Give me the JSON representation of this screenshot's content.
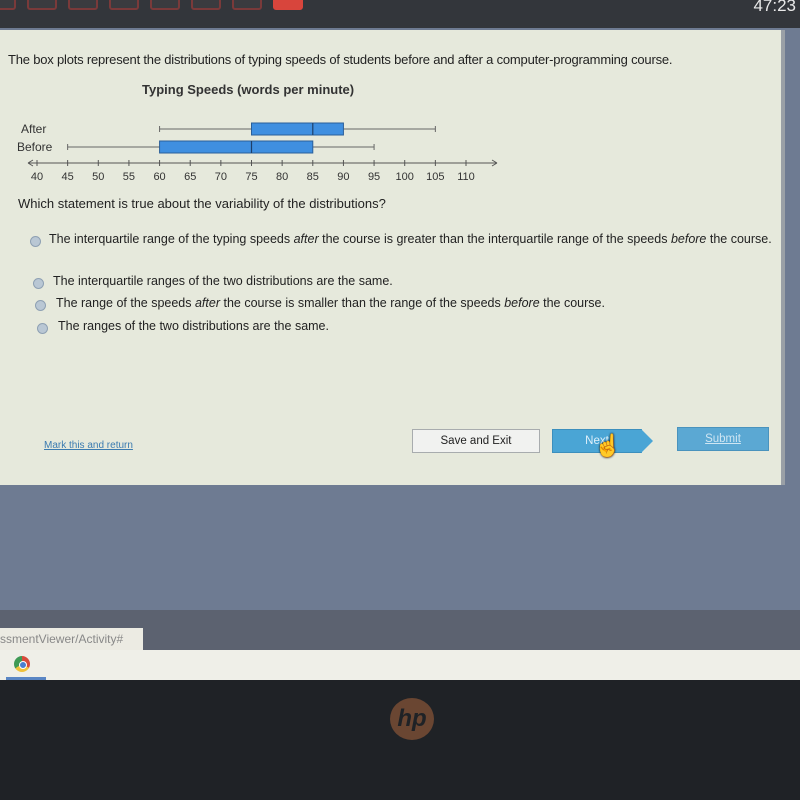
{
  "top_bar": {
    "question_nav_count": 8,
    "current_index": 7,
    "timer": "47:23"
  },
  "prompt": "The box plots represent the distributions of typing speeds of students before and after a computer-programming course.",
  "chart_data": {
    "type": "boxplot",
    "title": "Typing Speeds (words per minute)",
    "xlabel": "",
    "ylabel": "",
    "xlim": [
      40,
      110
    ],
    "x_ticks": [
      40,
      45,
      50,
      55,
      60,
      65,
      70,
      75,
      80,
      85,
      90,
      95,
      100,
      105,
      110
    ],
    "series": [
      {
        "name": "After",
        "min": 60,
        "q1": 75,
        "median": 85,
        "q3": 90,
        "max": 105
      },
      {
        "name": "Before",
        "min": 45,
        "q1": 60,
        "median": 75,
        "q3": 85,
        "max": 95
      }
    ],
    "box_color": "#3f8fe0",
    "grid": false
  },
  "question": "Which statement is true about the variability of the distributions?",
  "options": [
    {
      "parts": [
        "The interquartile range of the typing speeds ",
        "after",
        " the course is greater than the interquartile range of the speeds ",
        "before",
        " the course."
      ]
    },
    {
      "parts": [
        "The interquartile ranges of the two distributions are the same.",
        "",
        "",
        "",
        ""
      ]
    },
    {
      "parts": [
        "The range of the speeds ",
        "after",
        " the course is smaller than the range of the speeds ",
        "before",
        " the course."
      ]
    },
    {
      "parts": [
        "The ranges of the two distributions are the same.",
        "",
        "",
        "",
        ""
      ]
    }
  ],
  "footer": {
    "mark_link": "Mark this and return",
    "save_exit": "Save and Exit",
    "next": "Next",
    "submit": "Submit"
  },
  "browser": {
    "url_fragment": "ssmentViewer/Activity#"
  },
  "bezel": {
    "logo": "hp"
  }
}
